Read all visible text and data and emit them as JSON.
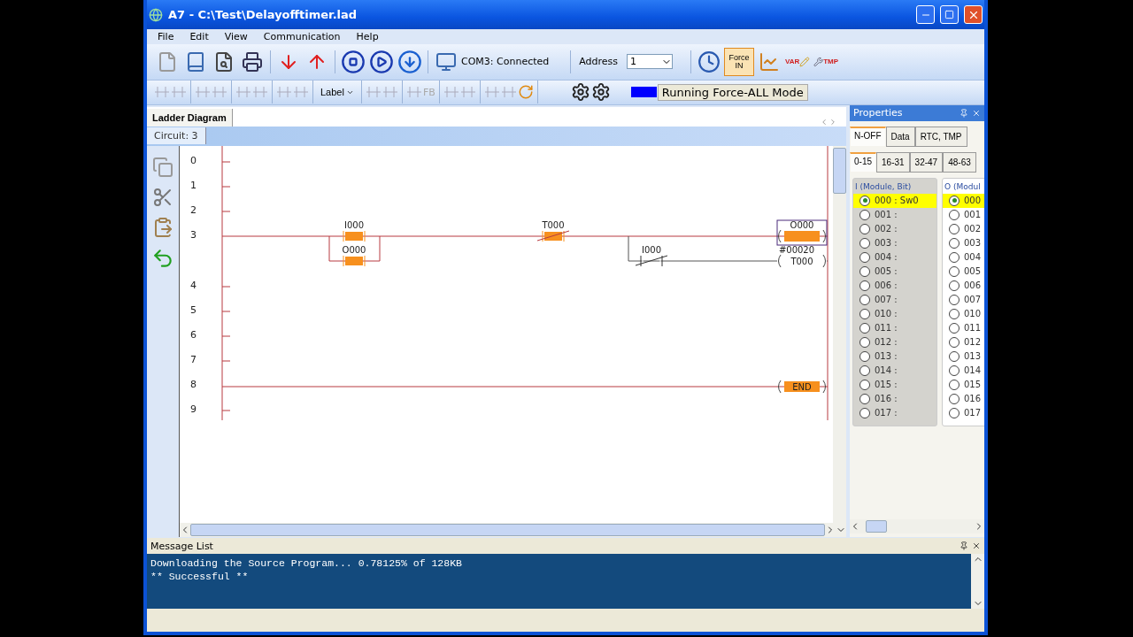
{
  "window": {
    "title": "A7 - C:\\Test\\Delayofftimer.lad"
  },
  "menu": [
    "File",
    "Edit",
    "View",
    "Communication",
    "Help"
  ],
  "toolbar": {
    "connection": "COM3: Connected",
    "address_label": "Address",
    "address_value": "1",
    "force_button": {
      "label": "Force IN",
      "pressed": true
    },
    "var_label": "VAR",
    "tmp_label": "TMP"
  },
  "ladder_toolbar": {
    "label_menu": "Label",
    "fb_label": "FB",
    "mode": "Running Force-ALL Mode"
  },
  "document_tab": {
    "label": "Ladder Diagram",
    "selected": true
  },
  "circuit": "Circuit: 3",
  "rungs": [
    {
      "number": "0"
    },
    {
      "number": "1"
    },
    {
      "number": "2"
    },
    {
      "number": "3",
      "elements": [
        {
          "kind": "contact_no",
          "label": "I000",
          "energized": true,
          "selected": false
        },
        {
          "kind": "contact_nc",
          "label": "T000",
          "energized": true,
          "selected": false
        },
        {
          "kind": "coil",
          "label": "O000",
          "energized": true,
          "selected": true
        },
        {
          "kind": "contact_no",
          "label": "O000",
          "energized": true,
          "selected": false
        },
        {
          "kind": "contact_nc",
          "label": "I000",
          "energized": false,
          "selected": false
        },
        {
          "kind": "timer",
          "label": "T000",
          "preset": "#00020",
          "energized": false,
          "selected": false
        }
      ]
    },
    {
      "number": "4"
    },
    {
      "number": "5"
    },
    {
      "number": "6"
    },
    {
      "number": "7"
    },
    {
      "number": "8",
      "elements": [
        {
          "kind": "end",
          "label": "END",
          "energized": true,
          "selected": false
        }
      ]
    },
    {
      "number": "9"
    }
  ],
  "properties": {
    "title": "Properties",
    "tabs": [
      {
        "label": "N-OFF",
        "selected": true
      },
      {
        "label": "Data",
        "selected": false
      },
      {
        "label": "RTC, TMP",
        "selected": false
      }
    ],
    "range_tabs": [
      {
        "label": "0-15",
        "selected": true
      },
      {
        "label": "16-31",
        "selected": false
      },
      {
        "label": "32-47",
        "selected": false
      },
      {
        "label": "48-63",
        "selected": false
      }
    ],
    "input_group": {
      "title": "I (Module, Bit)",
      "items": [
        {
          "label": "000 : Sw0",
          "selected": true
        },
        {
          "label": "001 :",
          "selected": false
        },
        {
          "label": "002 :",
          "selected": false
        },
        {
          "label": "003 :",
          "selected": false
        },
        {
          "label": "004 :",
          "selected": false
        },
        {
          "label": "005 :",
          "selected": false
        },
        {
          "label": "006 :",
          "selected": false
        },
        {
          "label": "007 :",
          "selected": false
        },
        {
          "label": "010 :",
          "selected": false
        },
        {
          "label": "011 :",
          "selected": false
        },
        {
          "label": "012 :",
          "selected": false
        },
        {
          "label": "013 :",
          "selected": false
        },
        {
          "label": "014 :",
          "selected": false
        },
        {
          "label": "015 :",
          "selected": false
        },
        {
          "label": "016 :",
          "selected": false
        },
        {
          "label": "017 :",
          "selected": false
        }
      ]
    },
    "output_group": {
      "title": "O (Modul",
      "items": [
        {
          "label": "000",
          "selected": true
        },
        {
          "label": "001",
          "selected": false
        },
        {
          "label": "002",
          "selected": false
        },
        {
          "label": "003",
          "selected": false
        },
        {
          "label": "004",
          "selected": false
        },
        {
          "label": "005",
          "selected": false
        },
        {
          "label": "006",
          "selected": false
        },
        {
          "label": "007",
          "selected": false
        },
        {
          "label": "010",
          "selected": false
        },
        {
          "label": "011",
          "selected": false
        },
        {
          "label": "012",
          "selected": false
        },
        {
          "label": "013",
          "selected": false
        },
        {
          "label": "014",
          "selected": false
        },
        {
          "label": "015",
          "selected": false
        },
        {
          "label": "016",
          "selected": false
        },
        {
          "label": "017",
          "selected": false
        }
      ]
    }
  },
  "message_list": {
    "title": "Message List",
    "lines": [
      "Downloading the Source Program... 0.78125% of 128KB",
      "** Successful **"
    ]
  }
}
